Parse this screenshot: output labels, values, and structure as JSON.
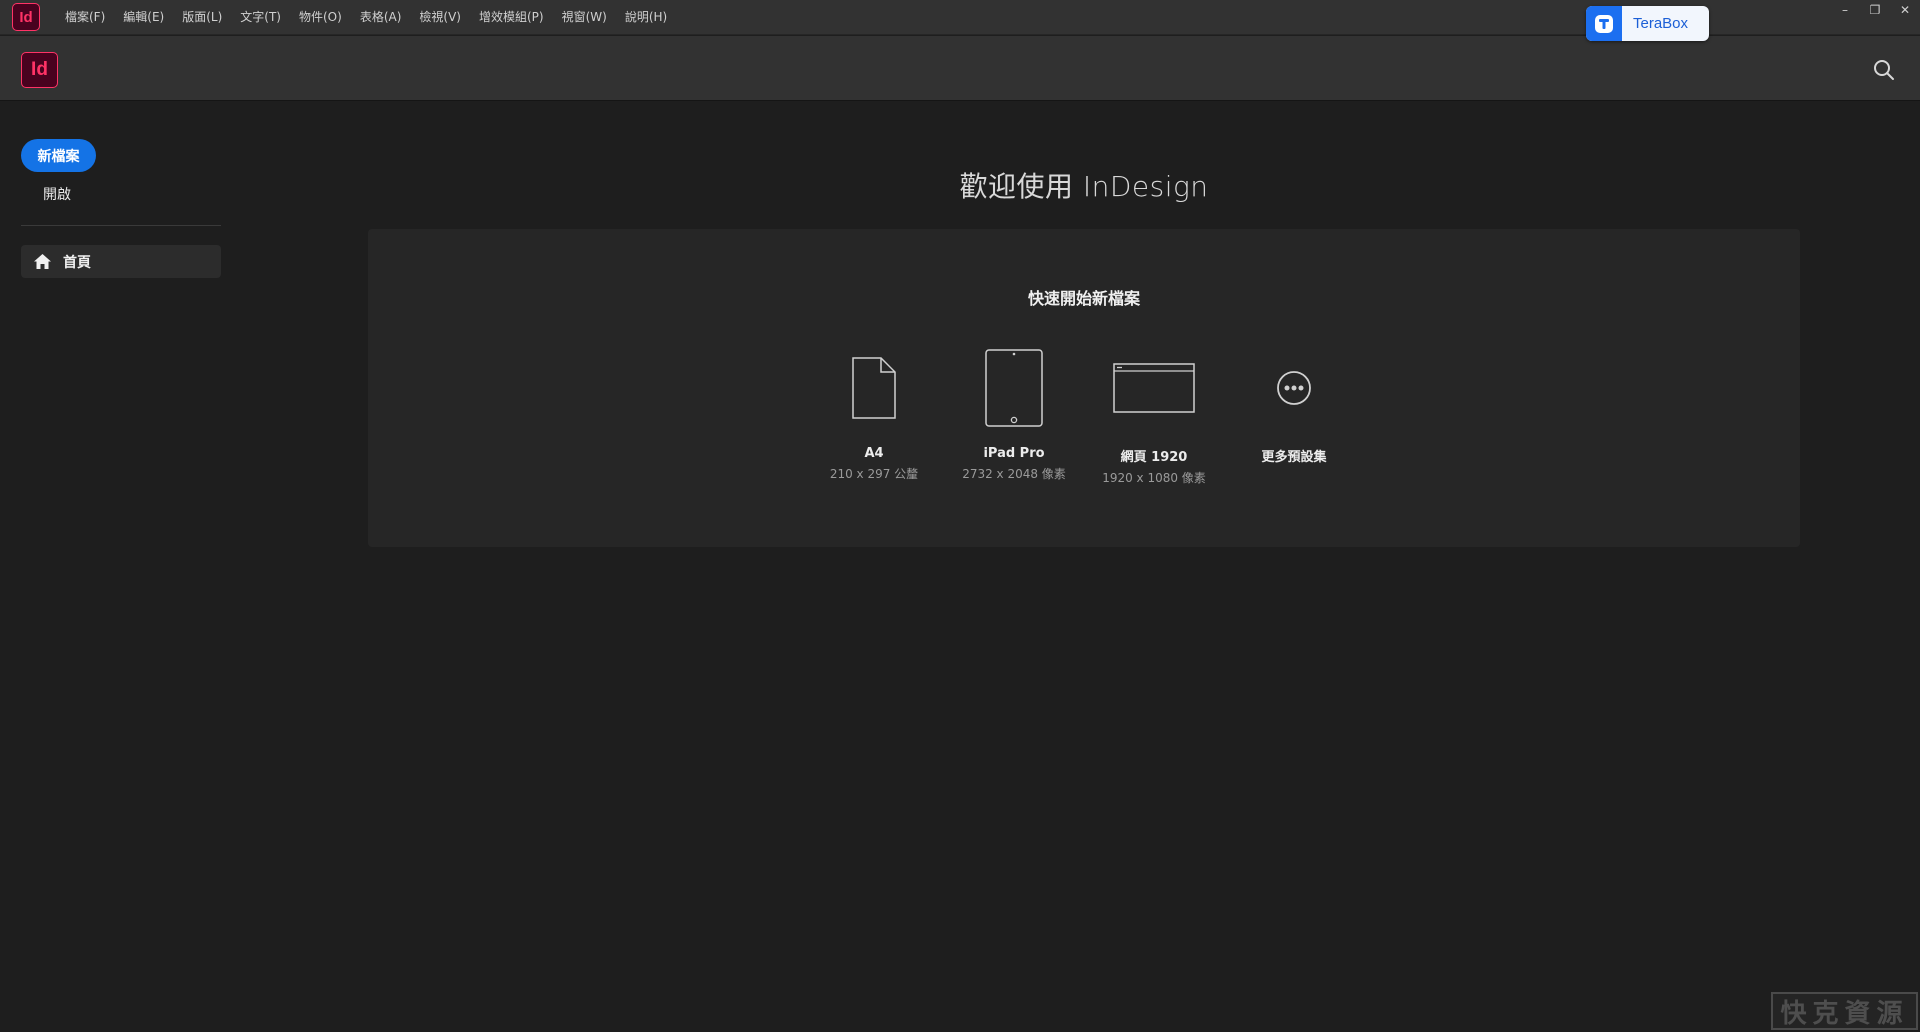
{
  "app": {
    "badge": "Id"
  },
  "menu": [
    {
      "label": "檔案(F)"
    },
    {
      "label": "編輯(E)"
    },
    {
      "label": "版面(L)"
    },
    {
      "label": "文字(T)"
    },
    {
      "label": "物件(O)"
    },
    {
      "label": "表格(A)"
    },
    {
      "label": "檢視(V)"
    },
    {
      "label": "增效模組(P)"
    },
    {
      "label": "視窗(W)"
    },
    {
      "label": "說明(H)"
    }
  ],
  "terabox": {
    "label": "TeraBox",
    "icon": "terabox-icon",
    "accent": "#1c6ff0"
  },
  "window_controls": {
    "minimize": "–",
    "restore": "❐",
    "close": "✕"
  },
  "header": {
    "logo": "Id",
    "search_icon": "search-icon"
  },
  "sidebar": {
    "new_label": "新檔案",
    "open_label": "開啟",
    "items": [
      {
        "label": "首頁",
        "icon": "home-icon",
        "selected": true
      }
    ]
  },
  "main": {
    "welcome": "歡迎使用 InDesign",
    "quickstart_title": "快速開始新檔案",
    "presets": [
      {
        "name": "A4",
        "size": "210 x 297 公釐",
        "icon": "document-icon"
      },
      {
        "name": "iPad Pro",
        "size": "2732 x 2048 像素",
        "icon": "tablet-icon"
      },
      {
        "name": "網頁 1920",
        "size": "1920 x 1080 像素",
        "icon": "browser-window-icon"
      },
      {
        "name": "更多預設集",
        "size": "",
        "icon": "more-icon"
      }
    ]
  },
  "watermark": "快克資源",
  "colors": {
    "accent": "#1473e6",
    "brand": "#ff3366",
    "background": "#1e1e1e",
    "panel": "#262626"
  }
}
